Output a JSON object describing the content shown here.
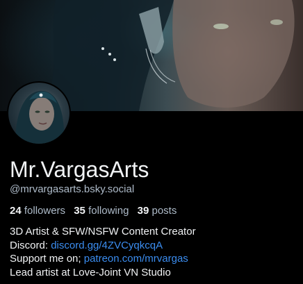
{
  "profile": {
    "display_name": "Mr.VargasArts",
    "handle": "@mrvargasarts.bsky.social",
    "banner_image": "banner-artwork",
    "avatar_image": "avatar-artwork"
  },
  "stats": {
    "followers_count": "24",
    "followers_label": "followers",
    "following_count": "35",
    "following_label": "following",
    "posts_count": "39",
    "posts_label": "posts"
  },
  "bio": {
    "line1": "3D Artist & SFW/NSFW Content Creator",
    "line2_prefix": "Discord: ",
    "line2_link": "discord.gg/4ZVCyqkcqA",
    "line3_prefix": "Support me on; ",
    "line3_link": "patreon.com/mrvargas",
    "line4": "Lead artist at Love-Joint VN Studio"
  },
  "colors": {
    "background": "#000000",
    "text": "#f1f3f5",
    "muted": "#aebbc9",
    "link": "#3b8df0"
  }
}
